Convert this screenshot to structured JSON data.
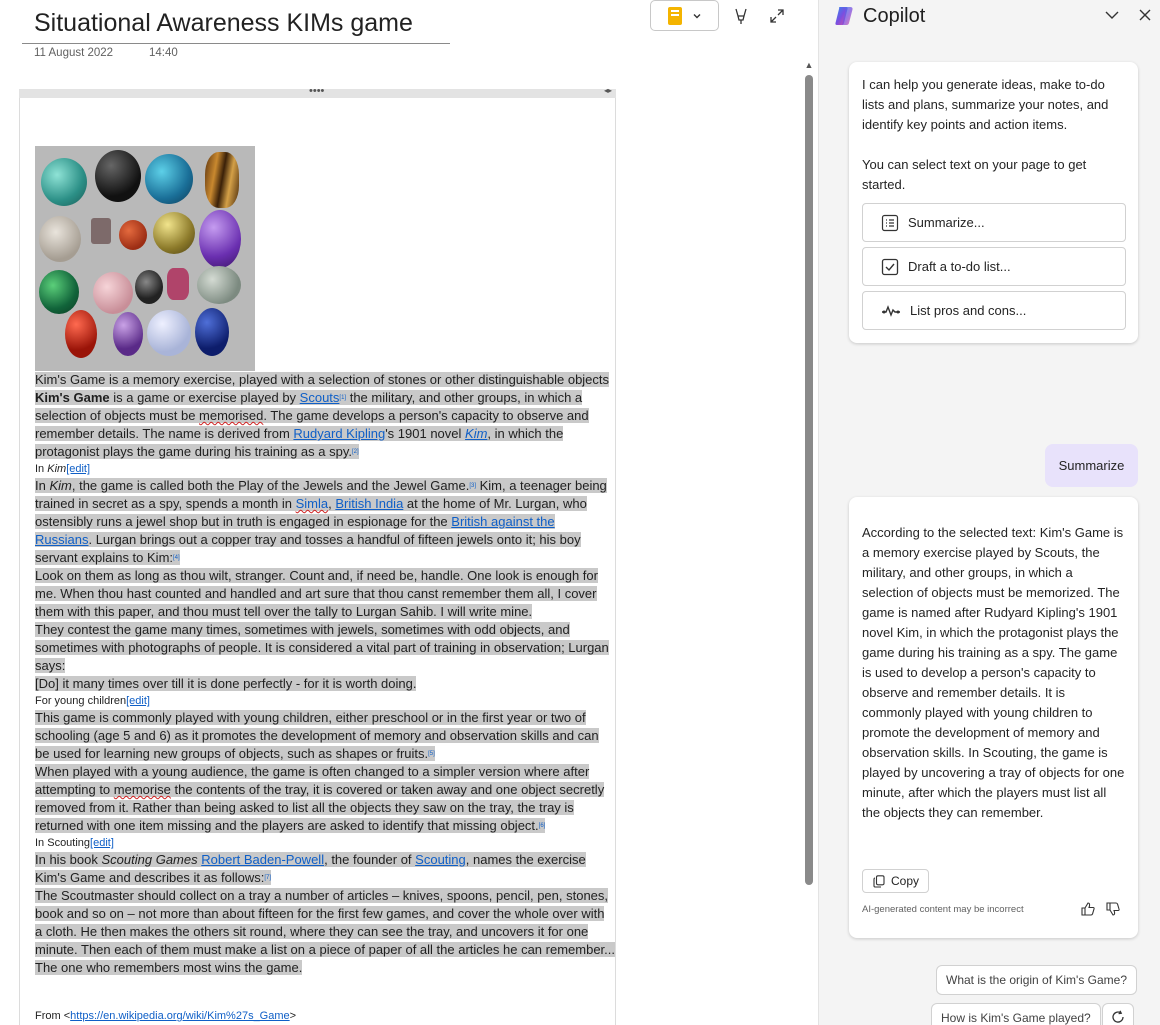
{
  "note": {
    "title": "Situational Awareness KIMs game",
    "date": "11 August 2022",
    "time": "14:40",
    "drag_handle": "••••",
    "image_caption": "Kim's Game is a memory exercise, played with a selection of stones or other distinguishable objects",
    "p1": {
      "bold": "Kim's Game",
      "t1": " is a game or exercise played by ",
      "scouts": "Scouts",
      "ref1": "[1]",
      "t2": " the military, and other groups, in which a selection of objects must be ",
      "memorised": "memorised",
      "t3": ". The game develops a person's capacity to observe and remember details. The name is derived from ",
      "kipling": "Rudyard Kipling",
      "t4": "'s 1901 novel ",
      "kim": "Kim",
      "t5": ", in which the protagonist plays the game during his training as a spy.",
      "ref2": "[2]"
    },
    "h_in_kim": {
      "pre": "In ",
      "kim": "Kim",
      "edit": "[edit]"
    },
    "p2": {
      "t1": "In ",
      "kim": "Kim",
      "t2": ", the game is called both the Play of the Jewels and the Jewel Game.",
      "ref3": "[3]",
      "t3": " Kim, a teenager being trained in secret as a spy, spends a month in ",
      "simla": "Simla",
      "comma": ", ",
      "british_india": "British India",
      "t4": " at the home of Mr. Lurgan, who ostensibly runs a jewel shop but in truth is engaged in espionage for the ",
      "british_against": "British against the Russians",
      "t5": ". Lurgan brings out a copper tray and tosses a handful of fifteen jewels onto it; his boy servant explains to Kim:",
      "ref4": "[4]"
    },
    "quote1": "Look on them as long as thou wilt, stranger. Count and, if need be, handle. One look is enough for me. When thou hast counted and handled and art sure that thou canst remember them all, I cover them with this paper, and thou must tell over the tally to Lurgan Sahib. I will write mine.",
    "p3": "They contest the game many times, sometimes with jewels, sometimes with odd objects, and sometimes with photographs of people. It is considered a vital part of training in observation; Lurgan says:",
    "quote2": "[Do] it many times over till it is done perfectly - for it is worth doing.",
    "h_young": {
      "text": "For young children",
      "edit": "[edit]"
    },
    "p4": {
      "text": "This game is commonly played with young children, either preschool or in the first year or two of schooling (age 5 and 6) as it promotes the development of memory and observation skills and can be used for learning new groups of objects, such as shapes or fruits.",
      "ref5": "[5]"
    },
    "p5": {
      "t1": "When played with a young audience, the game is often changed to a simpler version where after attempting to ",
      "memorise": "memorise",
      "t2": " the contents of the tray, it is covered or taken away and one object secretly removed from it. Rather than being asked to list all the objects they saw on the tray, the tray is returned with one item missing and the players are asked to identify that missing object.",
      "ref6": "[6]"
    },
    "h_scouting": {
      "text": "In Scouting",
      "edit": "[edit]"
    },
    "p6": {
      "t1": "In his book ",
      "book": "Scouting Games",
      "bp": "Robert Baden-Powell",
      "t2": ", the founder of ",
      "scouting": "Scouting",
      "t3": ", names the exercise Kim's Game and describes it as follows:",
      "ref7": "[7]"
    },
    "quote3": "The Scoutmaster should collect on a tray a number of articles – knives, spoons, pencil, pen, stones, book and so on – not more than about fifteen for the first few games, and cover the whole over with a cloth. He then makes the others sit round, where they can see the tray, and uncovers it for one minute. Then each of them must make a list on a piece of paper of all the articles he can remember... The one who remembers most wins the game.",
    "from": {
      "pre": "From <",
      "url": "https://en.wikipedia.org/wiki/Kim%27s_Game",
      "post": ">"
    }
  },
  "copilot": {
    "title": "Copilot",
    "intro_p1": "I can help you generate ideas, make to-do lists and plans, summarize your notes, and identify key points and action items.",
    "intro_p2": "You can select text on your page to get started.",
    "actions": [
      "Summarize...",
      "Draft a to-do list...",
      "List pros and cons..."
    ],
    "user_message": "Summarize",
    "answer": "According to the selected text: Kim's Game is a memory exercise played by Scouts, the military, and other groups, in which a selection of objects must be memorized. The game is named after Rudyard Kipling's 1901 novel Kim, in which the protagonist plays the game during his training as a spy. The game is used to develop a person's capacity to observe and remember details. It is commonly played with young children to promote the development of memory and observation skills. In Scouting, the game is played by uncovering a tray of objects for one minute, after which the players must list all the objects they can remember.",
    "copy_label": "Copy",
    "disclaimer": "AI-generated content may be incorrect",
    "suggestions": [
      "What is the origin of Kim's Game?",
      "How is Kim's Game played?"
    ],
    "accent": "#e8e2fb"
  }
}
